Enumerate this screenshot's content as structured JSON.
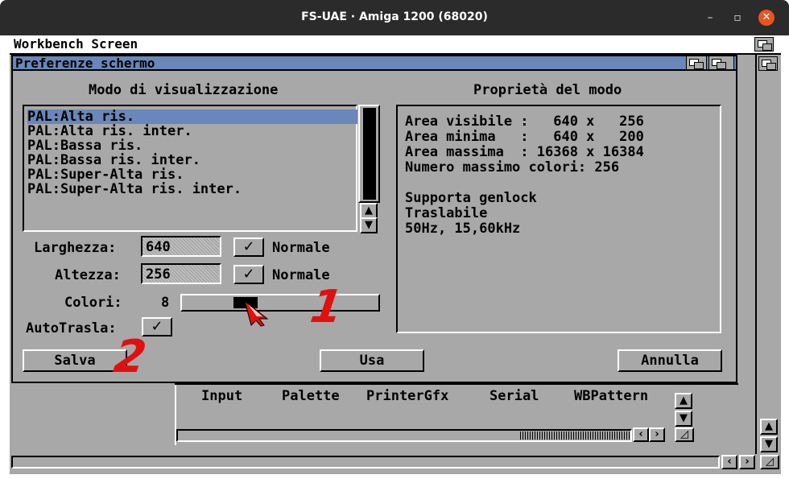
{
  "os_window": {
    "title": "FS-UAE · Amiga 1200 (68020)",
    "min": "–",
    "max": "▫",
    "close": "✕"
  },
  "workbench": {
    "screen_title": "Workbench Screen",
    "drawer_items": [
      "Input",
      "Palette",
      "PrinterGfx",
      "Serial",
      "WBPattern"
    ]
  },
  "dialog": {
    "title": "Preferenze schermo",
    "modes_heading": "Modo di visualizzazione",
    "props_heading": "Proprietà del modo",
    "modes": [
      "PAL:Alta ris.",
      "PAL:Alta ris. inter.",
      "PAL:Bassa ris.",
      "PAL:Bassa ris. inter.",
      "PAL:Super-Alta ris.",
      "PAL:Super-Alta ris. inter."
    ],
    "selected_mode_index": 0,
    "props": {
      "line1": "Area visibile :   640 x   256",
      "line2": "Area minima   :   640 x   200",
      "line3": "Area massima  : 16368 x 16384",
      "line4": "Numero massimo colori: 256",
      "line5": "Supporta genlock",
      "line6": "Traslabile",
      "line7": "50Hz, 15,60kHz"
    },
    "width_label": "Larghezza:",
    "width_value": "640",
    "height_label": "Altezza:",
    "height_value": "256",
    "normal_label": "Normale",
    "check_mark": "✓",
    "colors_label": "Colori:",
    "colors_value": "8",
    "colors_slider_fraction": 0.3,
    "autoscroll_label": "AutoTrasla:",
    "buttons": {
      "save": "Salva",
      "use": "Usa",
      "cancel": "Annulla"
    }
  },
  "annotations": {
    "one": "1",
    "two": "2"
  },
  "colors": {
    "amiga_gray": "#a8a8a8",
    "amiga_blue": "#6987b8",
    "annotation_red": "#e01010",
    "ubuntu_close": "#e95420"
  }
}
